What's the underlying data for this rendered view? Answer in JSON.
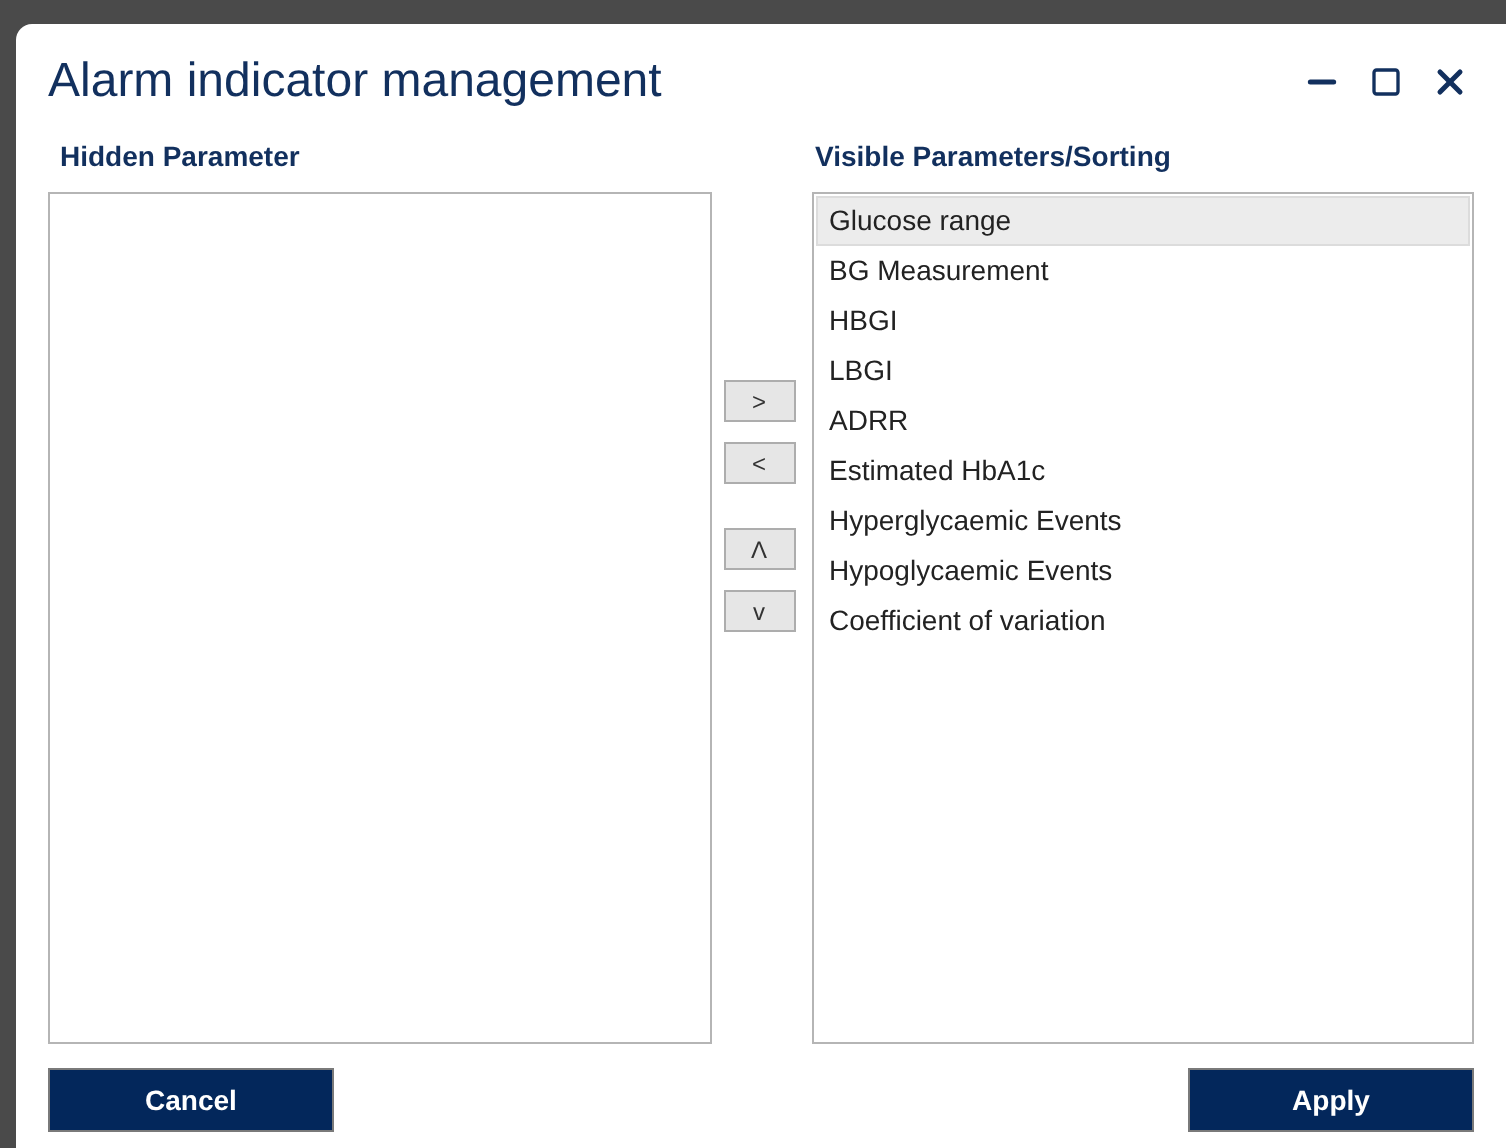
{
  "window": {
    "title": "Alarm indicator management"
  },
  "hidden_list": {
    "label": "Hidden Parameter"
  },
  "move_buttons": [
    ">",
    "<",
    "Λ",
    "v"
  ],
  "visible_list": {
    "label": "Visible Parameters/Sorting",
    "items": [
      {
        "label": "Glucose range",
        "selected": true
      },
      {
        "label": "BG Measurement",
        "selected": false
      },
      {
        "label": "HBGI",
        "selected": false
      },
      {
        "label": "LBGI",
        "selected": false
      },
      {
        "label": "ADRR",
        "selected": false
      },
      {
        "label": "Estimated HbA1c",
        "selected": false
      },
      {
        "label": "Hyperglycaemic Events",
        "selected": false
      },
      {
        "label": "Hypoglycaemic Events",
        "selected": false
      },
      {
        "label": "Coefficient of variation",
        "selected": false
      }
    ]
  },
  "buttons": {
    "cancel": "Cancel",
    "apply": "Apply"
  }
}
